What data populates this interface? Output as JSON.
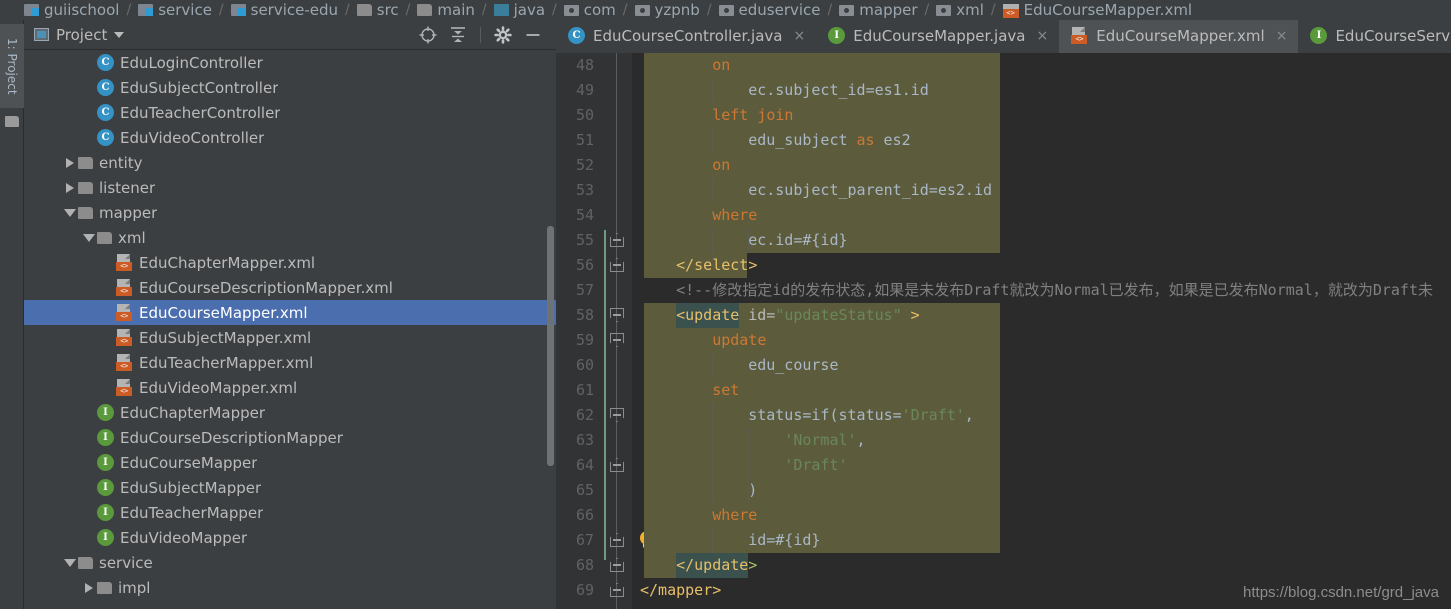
{
  "breadcrumb": [
    {
      "label": "guiischool",
      "icon": "module-icon"
    },
    {
      "label": "service",
      "icon": "module-icon"
    },
    {
      "label": "service-edu",
      "icon": "module-icon"
    },
    {
      "label": "src",
      "icon": "folder-icon"
    },
    {
      "label": "main",
      "icon": "folder-icon"
    },
    {
      "label": "java",
      "icon": "source-folder-icon"
    },
    {
      "label": "com",
      "icon": "package-icon"
    },
    {
      "label": "yzpnb",
      "icon": "package-icon"
    },
    {
      "label": "eduservice",
      "icon": "package-icon"
    },
    {
      "label": "mapper",
      "icon": "package-icon"
    },
    {
      "label": "xml",
      "icon": "package-icon"
    },
    {
      "label": "EduCourseMapper.xml",
      "icon": "xml-file-icon"
    }
  ],
  "left_strip": {
    "project_tab": "1: Project"
  },
  "project_panel": {
    "title": "Project",
    "toolbar_icons": [
      "locate-target-icon",
      "collapse-all-icon",
      "settings-gear-icon",
      "hide-minimize-icon"
    ],
    "tree": [
      {
        "label": "EduLoginController",
        "indent": 4,
        "icon": "class-icon",
        "twisty": "none",
        "selected": false
      },
      {
        "label": "EduSubjectController",
        "indent": 4,
        "icon": "class-icon",
        "twisty": "none",
        "selected": false
      },
      {
        "label": "EduTeacherController",
        "indent": 4,
        "icon": "class-icon",
        "twisty": "none",
        "selected": false
      },
      {
        "label": "EduVideoController",
        "indent": 4,
        "icon": "class-icon",
        "twisty": "none",
        "selected": false
      },
      {
        "label": "entity",
        "indent": 3,
        "icon": "folder-icon",
        "twisty": "right",
        "selected": false
      },
      {
        "label": "listener",
        "indent": 3,
        "icon": "folder-icon",
        "twisty": "right",
        "selected": false
      },
      {
        "label": "mapper",
        "indent": 3,
        "icon": "folder-icon",
        "twisty": "down",
        "selected": false
      },
      {
        "label": "xml",
        "indent": 4,
        "icon": "folder-icon",
        "twisty": "down",
        "selected": false
      },
      {
        "label": "EduChapterMapper.xml",
        "indent": 5,
        "icon": "xml-file-icon",
        "twisty": "none",
        "selected": false
      },
      {
        "label": "EduCourseDescriptionMapper.xml",
        "indent": 5,
        "icon": "xml-file-icon",
        "twisty": "none",
        "selected": false
      },
      {
        "label": "EduCourseMapper.xml",
        "indent": 5,
        "icon": "xml-file-icon",
        "twisty": "none",
        "selected": true
      },
      {
        "label": "EduSubjectMapper.xml",
        "indent": 5,
        "icon": "xml-file-icon",
        "twisty": "none",
        "selected": false
      },
      {
        "label": "EduTeacherMapper.xml",
        "indent": 5,
        "icon": "xml-file-icon",
        "twisty": "none",
        "selected": false
      },
      {
        "label": "EduVideoMapper.xml",
        "indent": 5,
        "icon": "xml-file-icon",
        "twisty": "none",
        "selected": false
      },
      {
        "label": "EduChapterMapper",
        "indent": 4,
        "icon": "interface-icon",
        "twisty": "none",
        "selected": false
      },
      {
        "label": "EduCourseDescriptionMapper",
        "indent": 4,
        "icon": "interface-icon",
        "twisty": "none",
        "selected": false
      },
      {
        "label": "EduCourseMapper",
        "indent": 4,
        "icon": "interface-icon",
        "twisty": "none",
        "selected": false
      },
      {
        "label": "EduSubjectMapper",
        "indent": 4,
        "icon": "interface-icon",
        "twisty": "none",
        "selected": false
      },
      {
        "label": "EduTeacherMapper",
        "indent": 4,
        "icon": "interface-icon",
        "twisty": "none",
        "selected": false
      },
      {
        "label": "EduVideoMapper",
        "indent": 4,
        "icon": "interface-icon",
        "twisty": "none",
        "selected": false
      },
      {
        "label": "service",
        "indent": 3,
        "icon": "folder-icon",
        "twisty": "down",
        "selected": false
      },
      {
        "label": "impl",
        "indent": 4,
        "icon": "folder-icon",
        "twisty": "right",
        "selected": false
      }
    ]
  },
  "editor": {
    "tabs": [
      {
        "label": "EduCourseController.java",
        "icon": "class-icon",
        "active": false,
        "closable": true
      },
      {
        "label": "EduCourseMapper.java",
        "icon": "interface-icon",
        "active": false,
        "closable": true
      },
      {
        "label": "EduCourseMapper.xml",
        "icon": "xml-file-icon",
        "active": true,
        "closable": true
      },
      {
        "label": "EduCourseService.java",
        "icon": "interface-icon",
        "active": false,
        "closable": false
      }
    ],
    "first_line_number": 48,
    "last_line_number": 69,
    "lines": [
      {
        "n": 48,
        "text": "        on"
      },
      {
        "n": 49,
        "text": "            ec.subject_id=es1.id"
      },
      {
        "n": 50,
        "text": "        left join"
      },
      {
        "n": 51,
        "text": "            edu_subject as es2"
      },
      {
        "n": 52,
        "text": "        on"
      },
      {
        "n": 53,
        "text": "            ec.subject_parent_id=es2.id"
      },
      {
        "n": 54,
        "text": "        where"
      },
      {
        "n": 55,
        "text": "            ec.id=#{id}"
      },
      {
        "n": 56,
        "text": "    </select>"
      },
      {
        "n": 57,
        "text": "    <!--修改指定id的发布状态,如果是未发布Draft就改为Normal已发布，如果是已发布Normal，就改为Draft未"
      },
      {
        "n": 58,
        "text": "    <update id=\"updateStatus\" >"
      },
      {
        "n": 59,
        "text": "        update"
      },
      {
        "n": 60,
        "text": "            edu_course"
      },
      {
        "n": 61,
        "text": "        set"
      },
      {
        "n": 62,
        "text": "            status=if(status='Draft',"
      },
      {
        "n": 63,
        "text": "                'Normal',"
      },
      {
        "n": 64,
        "text": "                'Draft'"
      },
      {
        "n": 65,
        "text": "            )"
      },
      {
        "n": 66,
        "text": "        where"
      },
      {
        "n": 67,
        "text": "            id=#{id}"
      },
      {
        "n": 68,
        "text": "    </update>"
      },
      {
        "n": 69,
        "text": "</mapper>"
      }
    ],
    "intention_bulb": {
      "line": 67,
      "icon": "lightbulb-icon"
    }
  },
  "watermark": "https://blog.csdn.net/grd_java",
  "colors": {
    "panel_bg": "#3c3f41",
    "editor_bg": "#2b2b2b",
    "gutter_bg": "#313335",
    "selection_blue": "#4b6eaf",
    "sql_fragment_bg": "#5c5c3d",
    "keyword_orange": "#cc7832",
    "string_green": "#6a8759",
    "tag_yellow": "#e8bf6a",
    "comment_grey": "#808080",
    "text_grey": "#a9b7c6",
    "xml_icon_orange": "#cc5c26",
    "class_icon_blue": "#3592c4",
    "interface_icon_green": "#5a9a3c"
  }
}
